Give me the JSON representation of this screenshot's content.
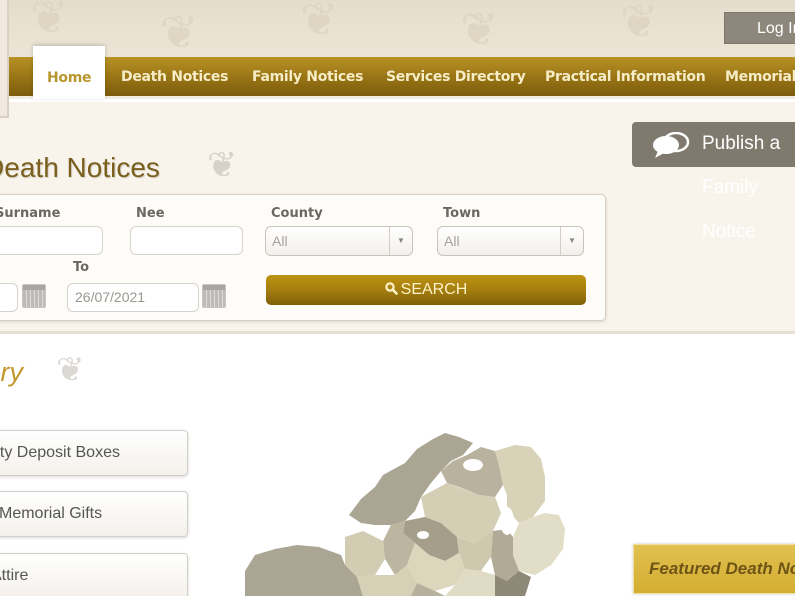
{
  "header": {
    "login_label": "Log In"
  },
  "nav": {
    "items": [
      {
        "label": "Home",
        "active": true
      },
      {
        "label": "Death Notices"
      },
      {
        "label": "Family Notices"
      },
      {
        "label": "Services Directory"
      },
      {
        "label": "Practical Information"
      },
      {
        "label": "Memorials"
      }
    ]
  },
  "publish": {
    "label": "Publish a Family Notice",
    "icon": "speech-bubbles-icon"
  },
  "search": {
    "title": "Latest Death Notices",
    "fields": {
      "surname_label": "Surname",
      "surname_value": "",
      "nee_label": "Nee",
      "nee_value": "",
      "county_label": "County",
      "county_value": "All",
      "town_label": "Town",
      "town_value": "All",
      "from_value": "",
      "to_label": "To",
      "to_value": "26/07/2021"
    },
    "search_label": "SEARCH",
    "search_icon": "magnifier-icon"
  },
  "directory": {
    "title": "Services Directory",
    "items": [
      {
        "label": "Safety Deposit Boxes"
      },
      {
        "label": "Memorial Gifts"
      },
      {
        "label": "Attire"
      }
    ]
  },
  "featured": {
    "label": "Featured Death Notices"
  },
  "colors": {
    "nav_gold": "#9a7616",
    "active_tab_text": "#b8962e",
    "title_brown": "#7a5f1e",
    "directory_gold": "#c3982c",
    "publish_gray": "#807a6e",
    "featured_gold": "#d4ae30"
  }
}
